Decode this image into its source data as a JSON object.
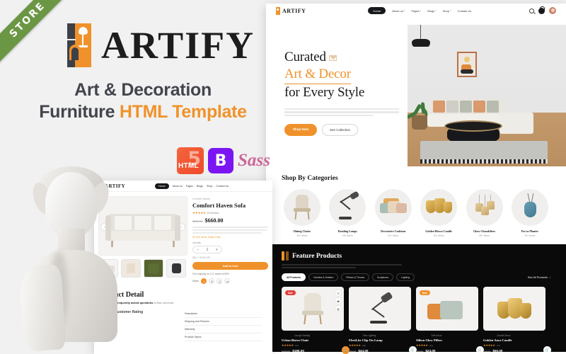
{
  "ribbon": {
    "label": "STORE"
  },
  "brand": {
    "name": "ARTIFY",
    "tagline_line1": "Art & Decoration",
    "tagline_line2_plain": "Furniture ",
    "tagline_line2_highlight": "HTML Template",
    "accent_color": "#f0922b",
    "ribbon_color": "#6b9643"
  },
  "tech_badges": [
    {
      "name": "html5-badge",
      "label": "HTML",
      "sup": "5"
    },
    {
      "name": "bootstrap-badge",
      "label": "B"
    },
    {
      "name": "sass-badge",
      "label": "Sass"
    }
  ],
  "product_page": {
    "logo": "ARTIFY",
    "nav": [
      {
        "label": "Home",
        "active": true
      },
      {
        "label": "About us",
        "active": false
      },
      {
        "label": "Pages",
        "active": false
      },
      {
        "label": "Blogs",
        "active": false
      },
      {
        "label": "Shop",
        "active": false
      },
      {
        "label": "Contact Us",
        "active": false
      }
    ],
    "breadcrumb": "Comfort Haven",
    "title": "Comfort Haven Sofa",
    "rating_stars": "★★★★★",
    "reviews": "32 Reviews",
    "price_old": "$890.00",
    "price_current": "$660.00",
    "stock": "IN 10 In Stock, Snap to ship",
    "qty_label": "Quantity",
    "qty_minus": "−",
    "qty_value": "1",
    "qty_plus": "+",
    "sku": "SKU : HV-001-SF",
    "add_to_cart": "Add to Cart",
    "shipping": "Free shipping on U.S. orders of $29+",
    "share_label": "Share:",
    "detail_heading": "Product Detail",
    "detail_text_pre": "you read our ",
    "detail_text_bold": "frequently asked questions",
    "detail_text_post": " to find out more.",
    "description_heading": "Description",
    "accordion": [
      {
        "label": "Shipping and Returns"
      },
      {
        "label": "Warranty"
      },
      {
        "label": "Product Specs"
      }
    ],
    "avg_rating_label": "Average Customer Rating"
  },
  "home_page": {
    "logo": "ARTIFY",
    "nav": [
      {
        "label": "Home",
        "active": true
      },
      {
        "label": "About us",
        "active": false
      },
      {
        "label": "Pages",
        "active": false
      },
      {
        "label": "Blogs",
        "active": false
      },
      {
        "label": "Shop",
        "active": false
      },
      {
        "label": "Contact Us",
        "active": false
      }
    ],
    "header_icons": [
      {
        "name": "search-icon"
      },
      {
        "name": "cart-icon"
      },
      {
        "name": "account-avatar"
      }
    ],
    "hero": {
      "line1": "Curated",
      "line2": "Art & Decor",
      "line3": "for Every Style",
      "btn_primary": "Shop Now",
      "btn_secondary": "See Collection"
    },
    "categories_title": "Shop By Categories",
    "categories": [
      {
        "name": "Dining Chairs",
        "items": "20+ items",
        "icon": "dining-chair-icon"
      },
      {
        "name": "Reading Lamps",
        "items": "20+ items",
        "icon": "reading-lamp-icon"
      },
      {
        "name": "Decorative Cushions",
        "items": "20+ items",
        "icon": "cushion-icon"
      },
      {
        "name": "Golden Blown Candle",
        "items": "20+ items",
        "icon": "candle-icon"
      },
      {
        "name": "Glass Chandeliers",
        "items": "20+ items",
        "icon": "chandelier-icon"
      },
      {
        "name": "Pot or Planter",
        "items": "20+ items",
        "icon": "planter-icon"
      }
    ],
    "features": {
      "title": "Feature Products",
      "see_all": "See All Products",
      "see_all_arrow": "›",
      "chips": [
        {
          "label": "All Products",
          "active": true
        },
        {
          "label": "Candles & Holders",
          "active": false
        },
        {
          "label": "Pillows & Throws",
          "active": false
        },
        {
          "label": "Sculptures",
          "active": false
        },
        {
          "label": "Lighting",
          "active": false
        }
      ],
      "products": [
        {
          "category": "Lounge Seating",
          "name": "Urban Bistro Chair",
          "stars": "★★★★★",
          "reviews": "(12)",
          "price_old": "$220.00",
          "price_current": "$185.00",
          "tag": "Sale",
          "tag_type": "sale"
        },
        {
          "category": "Task Lighting",
          "name": "FlexiLite Clip-On Lamp",
          "stars": "★★★★★",
          "reviews": "(08)",
          "price_old": "$60.00",
          "price_current": "$44.00",
          "tag": "",
          "tag_type": ""
        },
        {
          "category": "Soft Decor",
          "name": "Silken Glow Pillow",
          "stars": "★★★★★",
          "reviews": "(21)",
          "price_old": "$38.00",
          "price_current": "$24.00",
          "tag": "New",
          "tag_type": "new"
        },
        {
          "category": "Candle Decor",
          "name": "Golden Aura Candle",
          "stars": "★★★★★",
          "reviews": "(16)",
          "price_old": "$72.00",
          "price_current": "$50.00",
          "tag": "",
          "tag_type": ""
        }
      ]
    }
  }
}
